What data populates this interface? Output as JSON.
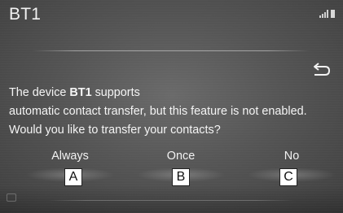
{
  "header": {
    "title": "BT1",
    "status_icons": [
      "signal-icon",
      "battery-icon"
    ]
  },
  "toolbar": {
    "back_icon": "return-arrow-icon"
  },
  "message": {
    "line1_prefix": "The device ",
    "device_name": "BT1",
    "line1_suffix": " supports",
    "line2": "automatic contact transfer, but this feature is not enabled.",
    "line3": "Would you like to transfer your contacts?"
  },
  "choices": [
    {
      "label": "Always",
      "callout": "A"
    },
    {
      "label": "Once",
      "callout": "B"
    },
    {
      "label": "No",
      "callout": "C"
    }
  ],
  "colors": {
    "screen_bg": "#555555",
    "text": "#f4f4f4"
  }
}
